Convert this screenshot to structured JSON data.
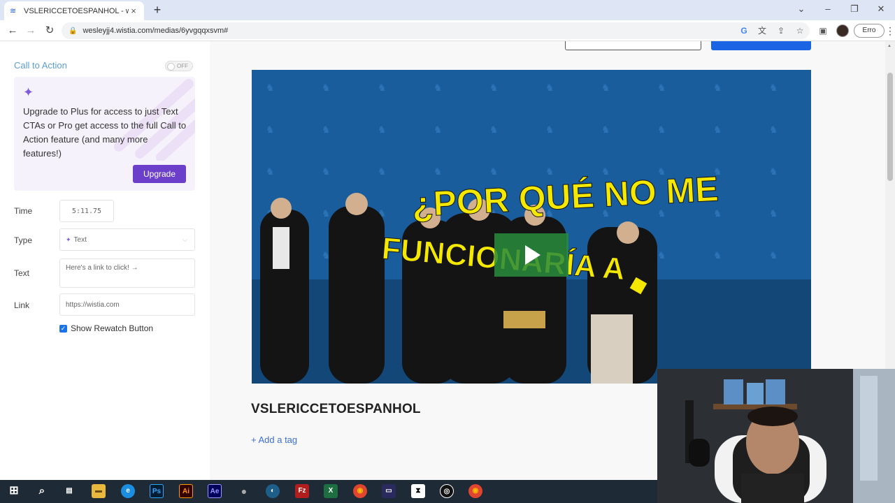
{
  "browser": {
    "tab_title": "VSLERICCETOESPANHOL - wesley",
    "url": "wesleyjj4.wistia.com/medias/6yvgqqxsvm#",
    "profile_label": "Erro"
  },
  "sidebar": {
    "cta_title": "Call to Action",
    "toggle_label": "OFF",
    "upgrade_text": "Upgrade to Plus for access to just Text CTAs or Pro get access to the full Call to Action feature (and many more features!)",
    "upgrade_button": "Upgrade",
    "fields": {
      "time_label": "Time",
      "time_value": "5:11.75",
      "type_label": "Type",
      "type_value": "Text",
      "text_label": "Text",
      "text_placeholder": "Here's a link to click! →",
      "link_label": "Link",
      "link_placeholder": "https://wistia.com"
    },
    "rewatch_label": "Show Rewatch Button",
    "rewatch_checked": true
  },
  "main": {
    "video_caption_line1": "¿POR QUÉ NO ME",
    "video_caption_line2": "FUNCIONARÍA A",
    "media_title": "VSLERICCETOESPANHOL",
    "add_tag_label": "+ Add a tag"
  },
  "colors": {
    "accent": "#6b3fc9",
    "link_blue": "#3b6fd4",
    "cta_title": "#5a9fd6",
    "caption_yellow": "#f5e800",
    "video_bg": "#1a5d9c"
  }
}
